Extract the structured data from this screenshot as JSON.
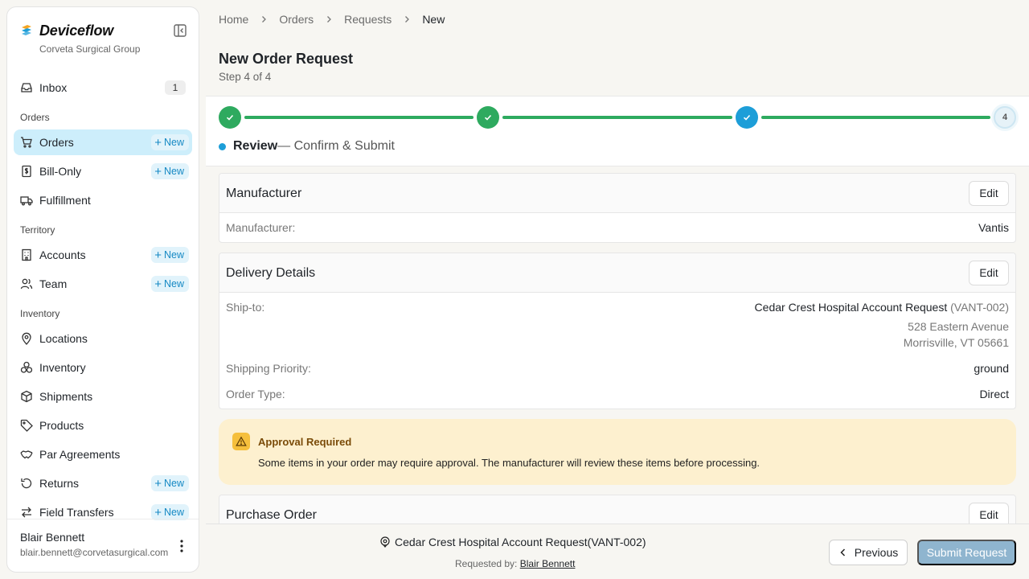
{
  "brand": {
    "name": "Deviceflow",
    "org": "Corveta Surgical Group"
  },
  "sidebar": {
    "inbox": {
      "label": "Inbox",
      "count": "1"
    },
    "sections": {
      "orders": "Orders",
      "territory": "Territory",
      "inventory": "Inventory"
    },
    "new_label": "New",
    "items": [
      {
        "label": "Orders"
      },
      {
        "label": "Bill-Only"
      },
      {
        "label": "Fulfillment"
      },
      {
        "label": "Accounts"
      },
      {
        "label": "Team"
      },
      {
        "label": "Locations"
      },
      {
        "label": "Inventory"
      },
      {
        "label": "Shipments"
      },
      {
        "label": "Products"
      },
      {
        "label": "Par Agreements"
      },
      {
        "label": "Returns"
      },
      {
        "label": "Field Transfers"
      }
    ],
    "user": {
      "name": "Blair Bennett",
      "email": "blair.bennett@corvetasurgical.com"
    }
  },
  "breadcrumb": [
    "Home",
    "Orders",
    "Requests",
    "New"
  ],
  "page": {
    "title": "New Order Request",
    "step": "Step 4 of 4"
  },
  "stepper": {
    "pending_number": "4",
    "caption_strong": "Review",
    "caption_rest": "— Confirm & Submit"
  },
  "cards": {
    "edit_label": "Edit",
    "manufacturer": {
      "title": "Manufacturer",
      "key": "Manufacturer:",
      "value": "Vantis"
    },
    "delivery": {
      "title": "Delivery Details",
      "ship_to_key": "Ship-to:",
      "ship_to_name": "Cedar Crest Hospital Account Request",
      "ship_to_code": "(VANT-002)",
      "address_line1": "528 Eastern Avenue",
      "address_line2": "Morrisville, VT 05661",
      "priority_key": "Shipping Priority:",
      "priority_value": "ground",
      "type_key": "Order Type:",
      "type_value": "Direct"
    },
    "purchase_order": {
      "title": "Purchase Order"
    }
  },
  "alert": {
    "title": "Approval Required",
    "text": "Some items in your order may require approval. The manufacturer will review these items before processing."
  },
  "footer": {
    "account": "Cedar Crest Hospital Account Request(VANT-002)",
    "requested_by_label": "Requested by:",
    "requested_by_name": "Blair Bennett",
    "previous_label": "Previous",
    "submit_label": "Submit Request"
  },
  "colors": {
    "accent": "#1d9ed8",
    "success": "#2eaa5f",
    "active_nav": "#cdeefb",
    "alert_bg": "#fdf0cf"
  }
}
